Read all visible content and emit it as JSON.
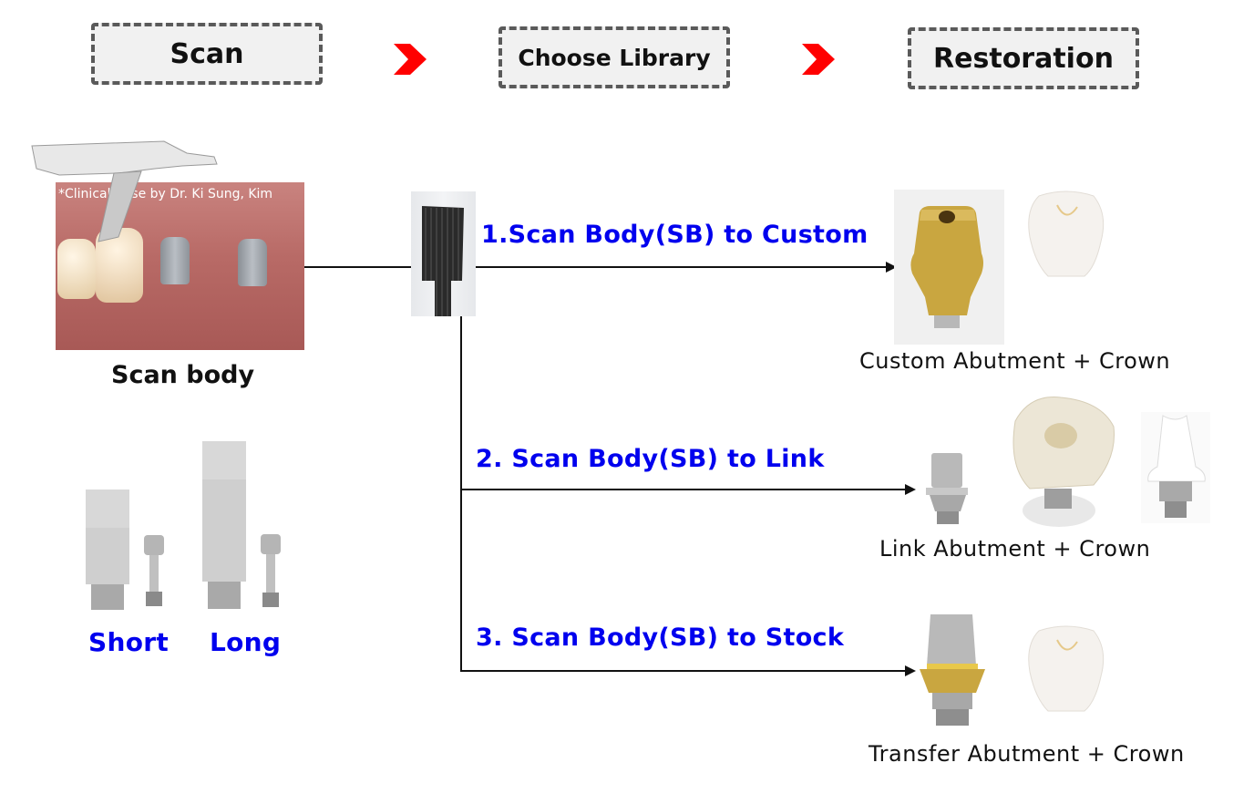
{
  "workflow_steps": [
    {
      "label": "Scan"
    },
    {
      "label": "Choose Library"
    },
    {
      "label": "Restoration"
    }
  ],
  "step_arrow_color": "#ff0000",
  "scan_section": {
    "photo_caption": "*Clinical Case by Dr. Ki Sung, Kim",
    "title": "Scan body",
    "variants": [
      {
        "label": "Short"
      },
      {
        "label": "Long"
      }
    ]
  },
  "paths": [
    {
      "label": "1.Scan Body(SB) to Custom",
      "result": "Custom Abutment + Crown"
    },
    {
      "label": "2. Scan Body(SB) to Link",
      "result": "Link Abutment + Crown"
    },
    {
      "label": "3. Scan Body(SB) to Stock",
      "result": "Transfer Abutment + Crown"
    }
  ],
  "colors": {
    "path_label": "#0000ee",
    "gold": "#c9a640",
    "gum": "#b86a66"
  }
}
